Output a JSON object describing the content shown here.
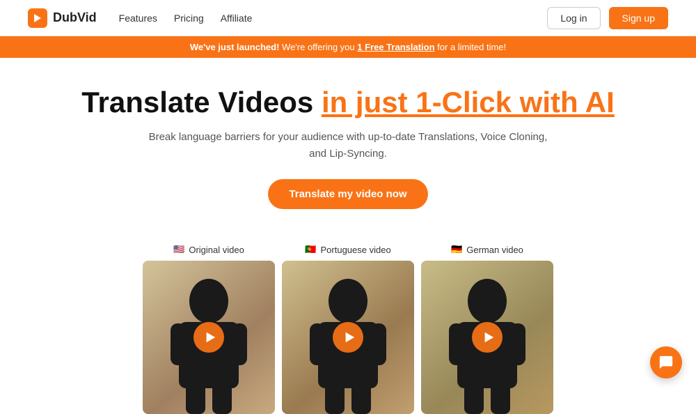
{
  "navbar": {
    "logo_text": "DubVid",
    "nav_links": [
      {
        "label": "Features",
        "id": "features"
      },
      {
        "label": "Pricing",
        "id": "pricing"
      },
      {
        "label": "Affiliate",
        "id": "affiliate"
      }
    ],
    "login_label": "Log in",
    "signup_label": "Sign up"
  },
  "banner": {
    "prefix": "We've just launched!",
    "middle": " We're offering you ",
    "link": "1 Free Translation",
    "suffix": " for a limited time!"
  },
  "hero": {
    "title_plain": "Translate Videos ",
    "title_orange": "in just 1-Click with AI",
    "subtitle_line1": "Break language barriers for your audience with up-to-date Translations, Voice Cloning,",
    "subtitle_line2": "and Lip-Syncing.",
    "cta_label": "Translate my video now"
  },
  "videos": [
    {
      "flag": "🇺🇸",
      "label": "Original video"
    },
    {
      "flag": "🇵🇹",
      "label": "Portuguese video"
    },
    {
      "flag": "🇩🇪",
      "label": "German video"
    }
  ],
  "chat": {
    "icon": "chat-icon"
  }
}
